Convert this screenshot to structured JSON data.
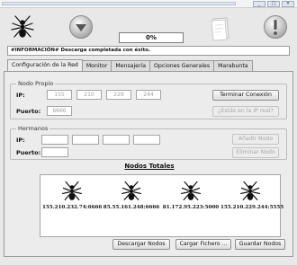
{
  "toolbar": {
    "progress_text": "0%",
    "progress_value": 0,
    "icons": [
      "ant-logo-icon",
      "download-arrow-icon",
      "document-icon",
      "warning-exclamation-icon"
    ]
  },
  "info": {
    "message": "#INFORMACIÓN# Descarga completada con éxito."
  },
  "tabs": [
    {
      "label": "Configuración de la Red"
    },
    {
      "label": "Monitor"
    },
    {
      "label": "Mensajería"
    },
    {
      "label": "Opciones Generales"
    },
    {
      "label": "Marabunta"
    }
  ],
  "nodo_propio": {
    "title": "Nodo Propio",
    "ip_label": "IP:",
    "ip": [
      "155",
      "210",
      "229",
      "244"
    ],
    "port_label": "Puerto:",
    "port": "6666",
    "terminar_button": "Terminar Conexión",
    "estas_button": "¿Estás en la IP real?"
  },
  "hermanos": {
    "title": "Hermanos",
    "ip_label": "IP:",
    "ip": [
      "",
      "",
      "",
      ""
    ],
    "port_label": "Puerto:",
    "port": "",
    "anadir_button": "Añadir Nodo",
    "eliminar_button": "Eliminar Nodo"
  },
  "nodos_totales": {
    "title": "Nodos Totales",
    "nodes": [
      {
        "ip": "155.210.232.74:6666"
      },
      {
        "ip": "85.55.161.248:6666"
      },
      {
        "ip": "81.172.95.223:5000"
      },
      {
        "ip": "155.210.229.244:5555"
      }
    ]
  },
  "bottom_buttons": {
    "descargar": "Descargar Nodos",
    "cargar": "Cargar Fichero ...",
    "guardar": "Guardar Nodos"
  }
}
